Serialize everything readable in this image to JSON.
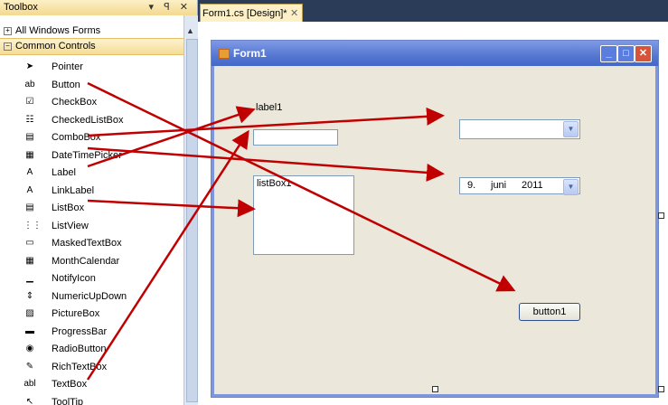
{
  "toolbox": {
    "title": "Toolbox",
    "title_buttons": "▾ ꟼ ✕",
    "group_all": "All Windows Forms",
    "group_common": "Common Controls",
    "tools": [
      {
        "label": "Pointer",
        "icon": "pointer-icon",
        "glyph": "➤"
      },
      {
        "label": "Button",
        "icon": "button-icon",
        "glyph": "ab"
      },
      {
        "label": "CheckBox",
        "icon": "checkbox-icon",
        "glyph": "☑"
      },
      {
        "label": "CheckedListBox",
        "icon": "checkedlistbox-icon",
        "glyph": "☷"
      },
      {
        "label": "ComboBox",
        "icon": "combobox-icon",
        "glyph": "▤"
      },
      {
        "label": "DateTimePicker",
        "icon": "datetimepicker-icon",
        "glyph": "▦"
      },
      {
        "label": "Label",
        "icon": "label-icon",
        "glyph": "A"
      },
      {
        "label": "LinkLabel",
        "icon": "linklabel-icon",
        "glyph": "A"
      },
      {
        "label": "ListBox",
        "icon": "listbox-icon",
        "glyph": "▤"
      },
      {
        "label": "ListView",
        "icon": "listview-icon",
        "glyph": "⋮⋮"
      },
      {
        "label": "MaskedTextBox",
        "icon": "maskedtextbox-icon",
        "glyph": "▭"
      },
      {
        "label": "MonthCalendar",
        "icon": "monthcalendar-icon",
        "glyph": "▦"
      },
      {
        "label": "NotifyIcon",
        "icon": "notifyicon-icon",
        "glyph": "▁"
      },
      {
        "label": "NumericUpDown",
        "icon": "numericupdown-icon",
        "glyph": "⇕"
      },
      {
        "label": "PictureBox",
        "icon": "picturebox-icon",
        "glyph": "▨"
      },
      {
        "label": "ProgressBar",
        "icon": "progressbar-icon",
        "glyph": "▬"
      },
      {
        "label": "RadioButton",
        "icon": "radiobutton-icon",
        "glyph": "◉"
      },
      {
        "label": "RichTextBox",
        "icon": "richtextbox-icon",
        "glyph": "✎"
      },
      {
        "label": "TextBox",
        "icon": "textbox-icon",
        "glyph": "abl"
      },
      {
        "label": "ToolTip",
        "icon": "tooltip-icon",
        "glyph": "↖"
      }
    ]
  },
  "tab": {
    "label": "Form1.cs [Design]*",
    "close": "✕"
  },
  "form": {
    "title": "Form1",
    "label1": "label1",
    "listbox_text": "listBox1",
    "date_day": "9.",
    "date_month": "juni",
    "date_year": "2011",
    "button_text": "button1"
  },
  "colors": {
    "arrow": "#c00000",
    "form_title": "#5577d2",
    "form_bg": "#ebe7da"
  }
}
